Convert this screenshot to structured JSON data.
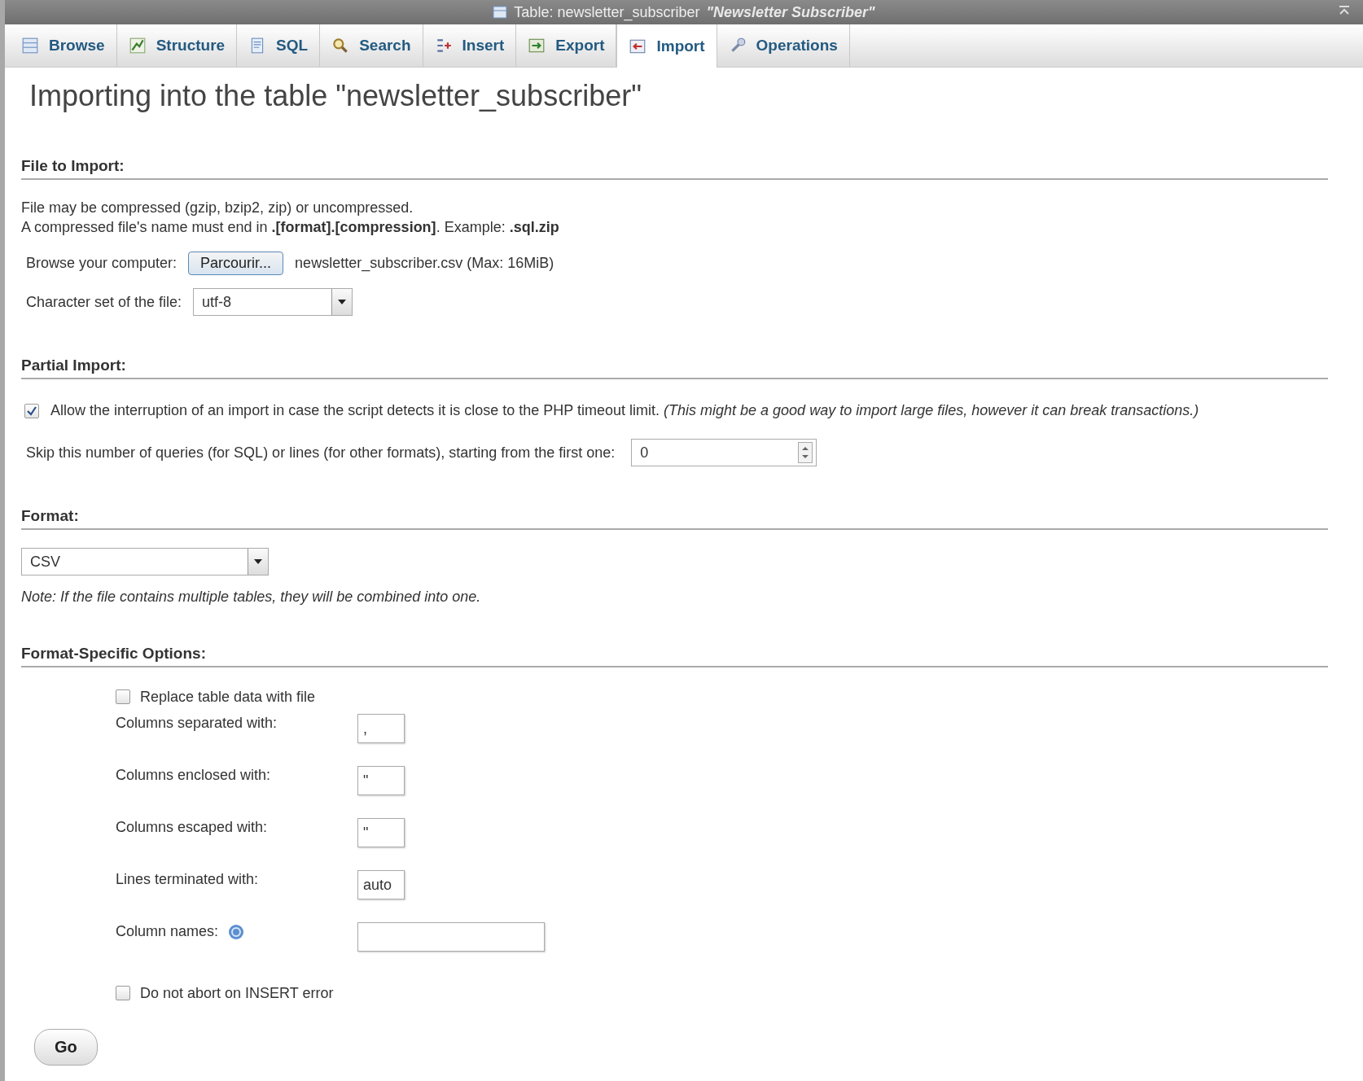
{
  "window": {
    "title": "Table: newsletter_subscriber",
    "comment": "\"Newsletter Subscriber\""
  },
  "tabs": [
    {
      "label": "Browse",
      "selected": false
    },
    {
      "label": "Structure",
      "selected": false
    },
    {
      "label": "SQL",
      "selected": false
    },
    {
      "label": "Search",
      "selected": false
    },
    {
      "label": "Insert",
      "selected": false
    },
    {
      "label": "Export",
      "selected": false
    },
    {
      "label": "Import",
      "selected": true
    },
    {
      "label": "Operations",
      "selected": false
    }
  ],
  "heading": "Importing into the table \"newsletter_subscriber\"",
  "file_section": {
    "title": "File to Import:",
    "note_1": "File may be compressed (gzip, bzip2, zip) or uncompressed.",
    "note_2": "A compressed file's name must end in **.[format].[compression]**. Example: **.sql.zip**",
    "browse_label": "Browse your computer:",
    "browse_button": "Parcourir...",
    "file_name": "newsletter_subscriber.csv (Max: 16MiB)",
    "charset_label": "Character set of the file:",
    "charset_value": "utf-8"
  },
  "partial_section": {
    "title": "Partial Import:",
    "allow_interrupt": {
      "checked": true,
      "label": "Allow the interruption of an import in case the script detects it is close to the PHP timeout limit.",
      "hint": "(This might be a good way to import large files, however it can break transactions.)"
    },
    "skip_label": "Skip this number of queries (for SQL) or lines (for other formats), starting from the first one:",
    "skip_value": "0"
  },
  "format_section": {
    "title": "Format:",
    "format_value": "CSV",
    "note": "Note: If the file contains multiple tables, they will be combined into one."
  },
  "options_section": {
    "title": "Format-Specific Options:",
    "options": [
      {
        "kind": "checkbox",
        "label": "Replace table data with file",
        "checked": false
      },
      {
        "kind": "text",
        "label": "Columns separated with:",
        "value": ","
      },
      {
        "kind": "text",
        "label": "Columns enclosed with:",
        "value": "\""
      },
      {
        "kind": "text",
        "label": "Columns escaped with:",
        "value": "\""
      },
      {
        "kind": "text",
        "label": "Lines terminated with:",
        "value": "auto"
      },
      {
        "kind": "wide",
        "label": "Column names:"
      },
      {
        "kind": "checkbox",
        "label": "Do not abort on INSERT error",
        "checked": false
      }
    ]
  },
  "go_button": "Go"
}
